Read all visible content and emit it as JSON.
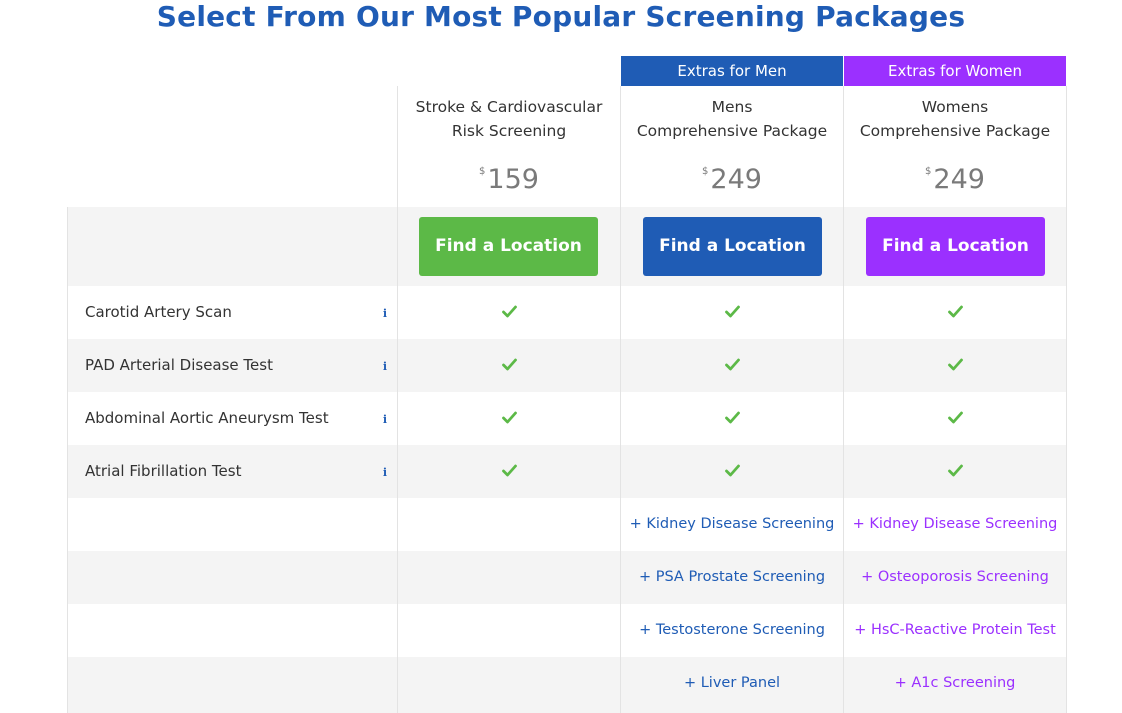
{
  "page": {
    "title": "Select From Our Most Popular Screening Packages"
  },
  "extras_tabs": {
    "men": "Extras for Men",
    "women": "Extras for Women"
  },
  "packages": [
    {
      "name": "Stroke & Cardiovascular\nRisk Screening",
      "currency": "$",
      "price": "159",
      "button": "Find a Location",
      "color": "#5cb947"
    },
    {
      "name": "Mens\nComprehensive Package",
      "currency": "$",
      "price": "249",
      "button": "Find a Location",
      "color": "#1f5cb5"
    },
    {
      "name": "Womens\nComprehensive Package",
      "currency": "$",
      "price": "249",
      "button": "Find a Location",
      "color": "#9b30ff"
    }
  ],
  "features": [
    {
      "label": "Carotid Artery Scan",
      "info_icon": "info-icon"
    },
    {
      "label": "PAD Arterial Disease Test",
      "info_icon": "info-icon"
    },
    {
      "label": "Abdominal Aortic Aneurysm Test",
      "info_icon": "info-icon"
    },
    {
      "label": "Atrial Fibrillation Test",
      "info_icon": "info-icon"
    }
  ],
  "check_icon": "checkmark-icon",
  "check_color": "#5cb947",
  "extras": {
    "men": [
      "+ Kidney Disease Screening",
      "+ PSA Prostate Screening",
      "+ Testosterone Screening",
      "+ Liver Panel"
    ],
    "women": [
      "+ Kidney Disease Screening",
      "+ Osteoporosis Screening",
      "+ HsC-Reactive Protein Test",
      "+ A1c Screening"
    ]
  },
  "colors": {
    "brand_blue": "#1f5cb5",
    "brand_purple": "#9b30ff",
    "brand_green": "#5cb947"
  }
}
